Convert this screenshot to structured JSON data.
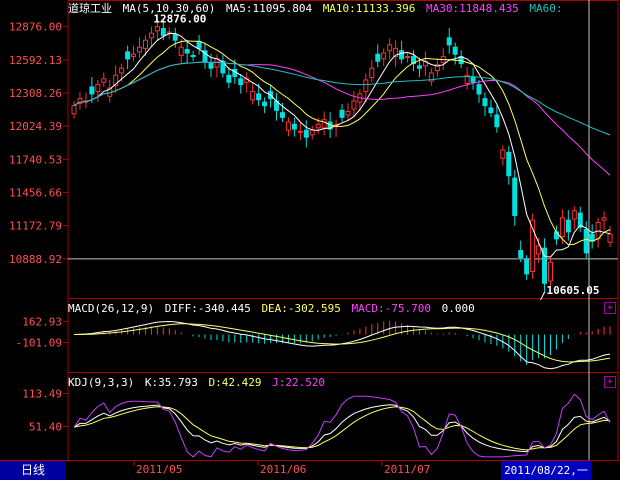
{
  "app": {
    "title": "道琼工业",
    "period_tab": "日线",
    "cursor_date": "2011/08/22,一"
  },
  "header": {
    "ma_label": "MA(5,10,30,60)",
    "ma5": "MA5:11095.804",
    "ma10": "MA10:11133.396",
    "ma30": "MA30:11848.435",
    "ma60": "MA60:"
  },
  "macd_header": {
    "label": "MACD(26,12,9)",
    "diff": "DIFF:-340.445",
    "dea": "DEA:-302.595",
    "macd": "MACD:-75.700",
    "zero": "0.000"
  },
  "kdj_header": {
    "label": "KDJ(9,3,3)",
    "k": "K:35.793",
    "d": "D:42.429",
    "j": "J:22.520"
  },
  "colors": {
    "up": "#ff3030",
    "down": "#00e0e0",
    "ma5": "#ffffff",
    "ma10": "#ffff60",
    "ma30": "#ff40ff",
    "ma60": "#20c0c0",
    "axis": "#b00000",
    "axis_text": "#ff5050",
    "dea": "#ffff60",
    "kdj_j": "#c040ff"
  },
  "chart_data": {
    "type": "candlestick",
    "price_axis": [
      "12876.00",
      "12592.13",
      "12308.26",
      "12024.39",
      "11740.53",
      "11456.66",
      "11172.79",
      "10888.92"
    ],
    "price_range": [
      10605,
      12950
    ],
    "macd_axis": [
      "162.93",
      "-101.09"
    ],
    "macd_range": [
      -440,
      230
    ],
    "kdj_axis": [
      "113.49",
      "51.40"
    ],
    "kdj_range": [
      -8,
      120
    ],
    "x_labels": [
      "2011/05",
      "2011/06",
      "2011/07"
    ],
    "annotations": {
      "high": "12876.00",
      "low": "10605.05"
    },
    "closes": [
      12200,
      12260,
      12240,
      12300,
      12380,
      12430,
      12350,
      12460,
      12520,
      12600,
      12640,
      12700,
      12760,
      12820,
      12876,
      12800,
      12830,
      12760,
      12700,
      12650,
      12620,
      12690,
      12580,
      12520,
      12600,
      12480,
      12400,
      12450,
      12380,
      12430,
      12320,
      12250,
      12200,
      12260,
      12160,
      12100,
      12060,
      12000,
      11980,
      11930,
      11990,
      12040,
      12080,
      12000,
      12040,
      12100,
      12150,
      12240,
      12300,
      12420,
      12520,
      12580,
      12650,
      12720,
      12690,
      12600,
      12620,
      12560,
      12520,
      12580,
      12480,
      12550,
      12620,
      12720,
      12640,
      12560,
      12460,
      12400,
      12300,
      12200,
      12140,
      12020,
      11820,
      11600,
      11260,
      10900,
      10760,
      11220,
      11000,
      10680,
      10860,
      11060,
      11240,
      11120,
      11300,
      11160,
      10940,
      11040,
      11200,
      11240,
      11100
    ]
  }
}
